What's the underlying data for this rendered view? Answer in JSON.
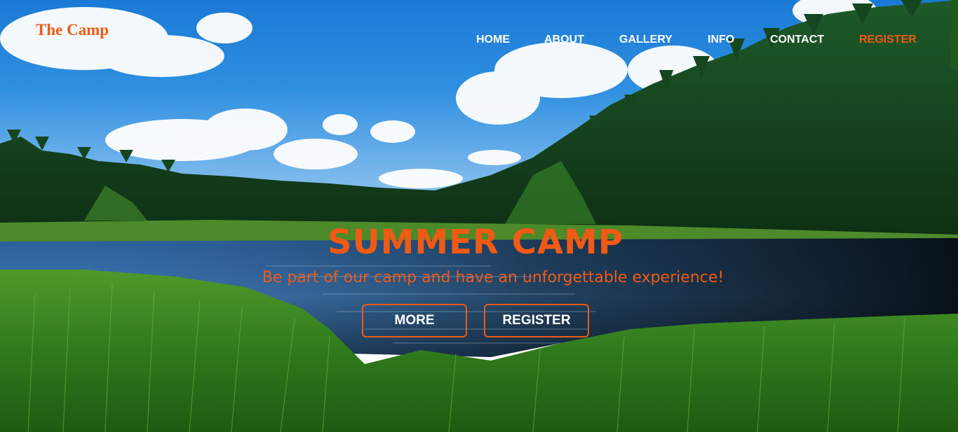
{
  "header": {
    "logo": "The Camp",
    "nav": [
      {
        "label": "HOME"
      },
      {
        "label": "ABOUT"
      },
      {
        "label": "GALLERY"
      },
      {
        "label": "INFO"
      },
      {
        "label": "CONTACT"
      },
      {
        "label": "REGISTER",
        "active": true
      }
    ]
  },
  "hero": {
    "title": "SUMMER CAMP",
    "subtitle": "Be part of our camp and have an unforgettable experience!",
    "buttons": {
      "more": "MORE",
      "register": "REGISTER"
    }
  },
  "colors": {
    "accent": "#f05a14",
    "nav_text": "#ffffff"
  }
}
